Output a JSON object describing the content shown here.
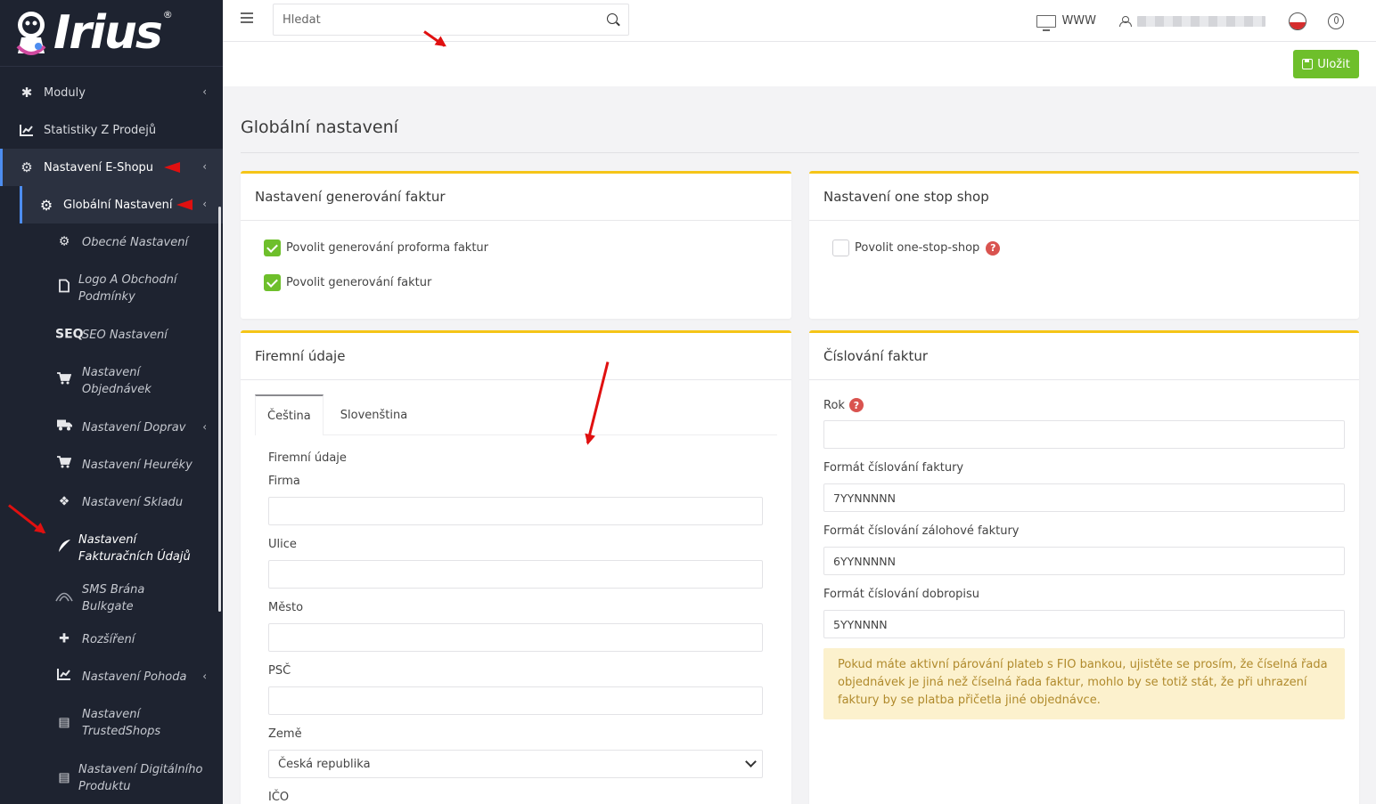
{
  "brand": {
    "name": "Irius",
    "reg": "®"
  },
  "sidebar": {
    "modules": "Moduly",
    "stats": "Statistiky Z Prodejů",
    "eshop": "Nastavení E-Shopu",
    "global": "Globální Nastavení",
    "items": [
      {
        "label": "Obecné Nastavení",
        "icon": "gear-icon",
        "glyph": "⚙"
      },
      {
        "label": "Logo A Obchodní Podmínky",
        "icon": "document-icon",
        "glyph": "▯"
      },
      {
        "label": "SEO Nastavení",
        "icon": "seo-icon",
        "glyph": "SEQ"
      },
      {
        "label": "Nastavení Objednávek",
        "icon": "cart-icon",
        "glyph": "🛒"
      },
      {
        "label": "Nastavení Doprav",
        "icon": "truck-icon",
        "glyph": "🚚"
      },
      {
        "label": "Nastavení Heuréky",
        "icon": "cart-icon",
        "glyph": "🛒"
      },
      {
        "label": "Nastavení Skladu",
        "icon": "dropbox-icon",
        "glyph": "❖"
      },
      {
        "label": "Nastavení Fakturačních Údajů",
        "icon": "feather-icon",
        "glyph": "✒"
      },
      {
        "label": "SMS Brána Bulkgate",
        "icon": "signal-icon",
        "glyph": "◠"
      },
      {
        "label": "Rozšíření",
        "icon": "puzzle-icon",
        "glyph": "✚"
      },
      {
        "label": "Nastavení Pohoda",
        "icon": "chart-icon",
        "glyph": "📈"
      },
      {
        "label": "Nastavení TrustedShops",
        "icon": "card-icon",
        "glyph": "▤"
      },
      {
        "label": "Nastavení Digitálního Produktu",
        "icon": "card-icon",
        "glyph": "▤"
      }
    ]
  },
  "topbar": {
    "search_placeholder": "Hledat",
    "www": "WWW"
  },
  "actions": {
    "save": "Uložit"
  },
  "page": {
    "title": "Globální nastavení"
  },
  "invoice_gen": {
    "title": "Nastavení generování faktur",
    "opt1": "Povolit generování proforma faktur",
    "opt2": "Povolit generování faktur"
  },
  "oss": {
    "title": "Nastavení one stop shop",
    "opt": "Povolit one-stop-shop"
  },
  "company": {
    "title": "Firemní údaje",
    "tab_cs": "Čeština",
    "tab_sk": "Slovenština",
    "section": "Firemní údaje",
    "firma": "Firma",
    "ulice": "Ulice",
    "mesto": "Město",
    "psc": "PSČ",
    "zeme": "Země",
    "zeme_value": "Česká republika",
    "ico": "IČO"
  },
  "numbering": {
    "title": "Číslování faktur",
    "rok": "Rok",
    "f1_label": "Formát číslování faktury",
    "f1_value": "7YYNNNNN",
    "f2_label": "Formát číslování zálohové faktury",
    "f2_value": "6YYNNNNN",
    "f3_label": "Formát číslování dobropisu",
    "f3_value": "5YYNNNN",
    "notice": "Pokud máte aktivní párování plateb s FIO bankou, ujistěte se prosím, že číselná řada objednávek je jiná než číselná řada faktur, mohlo by se totiž stát, že při uhrazení faktury by se platba přičetla jiné objednávce."
  },
  "colors": {
    "sidebar_bg": "#1e2330",
    "accent": "#f5c518",
    "save_green": "#6ebf2b",
    "active_border": "#4d8df0"
  }
}
